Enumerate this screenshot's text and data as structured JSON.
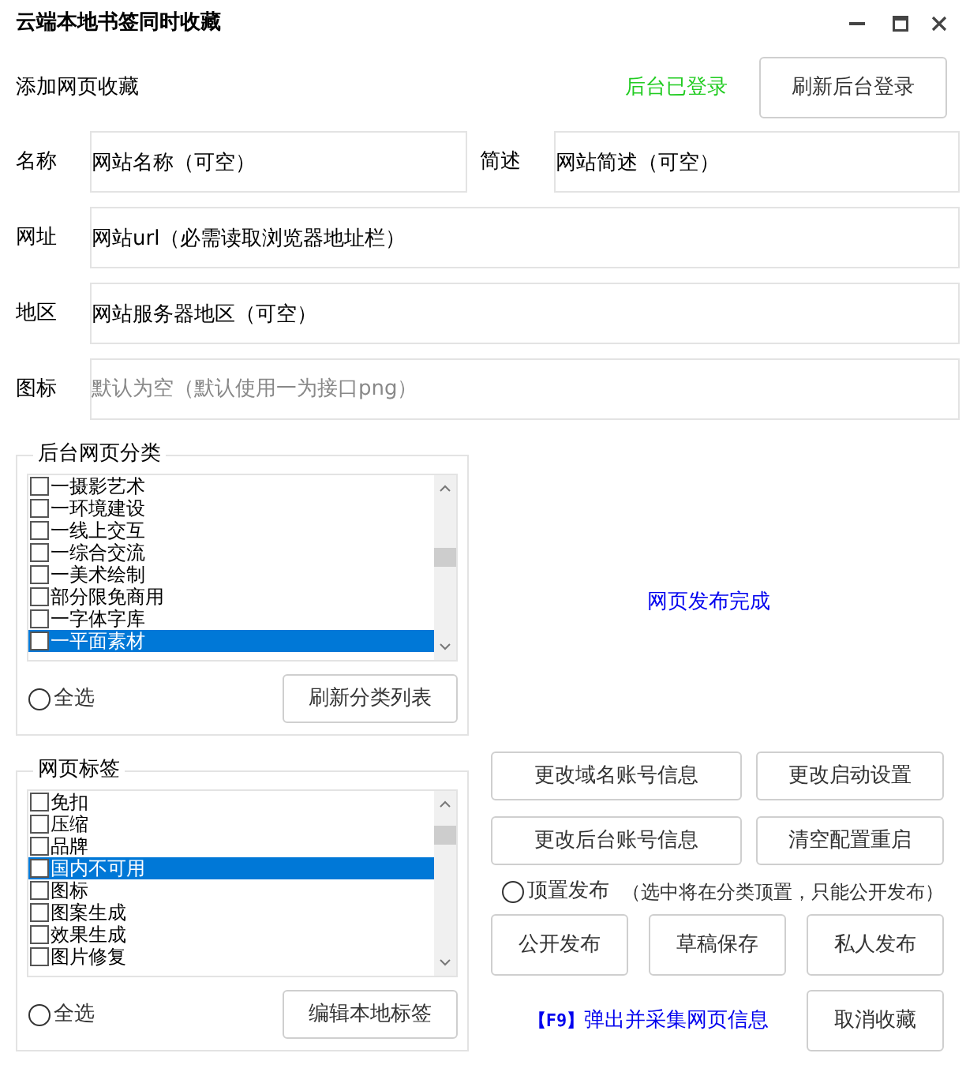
{
  "window": {
    "title": "云端本地书签同时收藏"
  },
  "header": {
    "label": "添加网页收藏",
    "status": "后台已登录",
    "button": "刷新后台登录"
  },
  "fields": [
    {
      "label": "名称",
      "value": "网站名称（可空）"
    },
    {
      "label": "简述",
      "value": "网站简述（可空）"
    },
    {
      "label": "网址",
      "value": "网站url（必需读取浏览器地址栏）"
    },
    {
      "label": "地区",
      "value": "网站服务器地区（可空）"
    },
    {
      "label": "图标",
      "placeholder": "默认为空（默认使用一为接口png）"
    }
  ],
  "categories": {
    "title": "后台网页分类",
    "items": [
      {
        "label": "一摄影艺术",
        "checked": false,
        "selected": false
      },
      {
        "label": "一环境建设",
        "checked": false,
        "selected": false
      },
      {
        "label": "一线上交互",
        "checked": false,
        "selected": false
      },
      {
        "label": "一综合交流",
        "checked": false,
        "selected": false
      },
      {
        "label": "一美术绘制",
        "checked": false,
        "selected": false
      },
      {
        "label": "部分限免商用",
        "checked": false,
        "selected": false
      },
      {
        "label": "一字体字库",
        "checked": false,
        "selected": false
      },
      {
        "label": "一平面素材",
        "checked": false,
        "selected": true
      }
    ],
    "select_all": {
      "label": "全选",
      "checked": false
    },
    "button": "刷新分类列表"
  },
  "tags": {
    "title": "网页标签",
    "items": [
      {
        "label": "免扣",
        "checked": false,
        "selected": false
      },
      {
        "label": "压缩",
        "checked": false,
        "selected": false
      },
      {
        "label": "品牌",
        "checked": false,
        "selected": false
      },
      {
        "label": "国内不可用",
        "checked": false,
        "selected": true
      },
      {
        "label": "图标",
        "checked": false,
        "selected": false
      },
      {
        "label": "图案生成",
        "checked": false,
        "selected": false
      },
      {
        "label": "效果生成",
        "checked": false,
        "selected": false
      },
      {
        "label": "图片修复",
        "checked": false,
        "selected": false
      }
    ],
    "select_all": {
      "label": "全选",
      "checked": false
    },
    "button": "编辑本地标签"
  },
  "status_message": "网页发布完成",
  "settings_buttons": [
    "更改域名账号信息",
    "更改启动设置",
    "更改后台账号信息",
    "清空配置重启"
  ],
  "pin_option": {
    "label": "顶置发布",
    "checked": false,
    "note": "（选中将在分类顶置，只能公开发布）"
  },
  "publish_buttons": [
    "公开发布",
    "草稿保存",
    "私人发布"
  ],
  "hotkey_hint": {
    "key": "【F9】",
    "text": "弹出并采集网页信息"
  },
  "cancel_button": "取消收藏"
}
